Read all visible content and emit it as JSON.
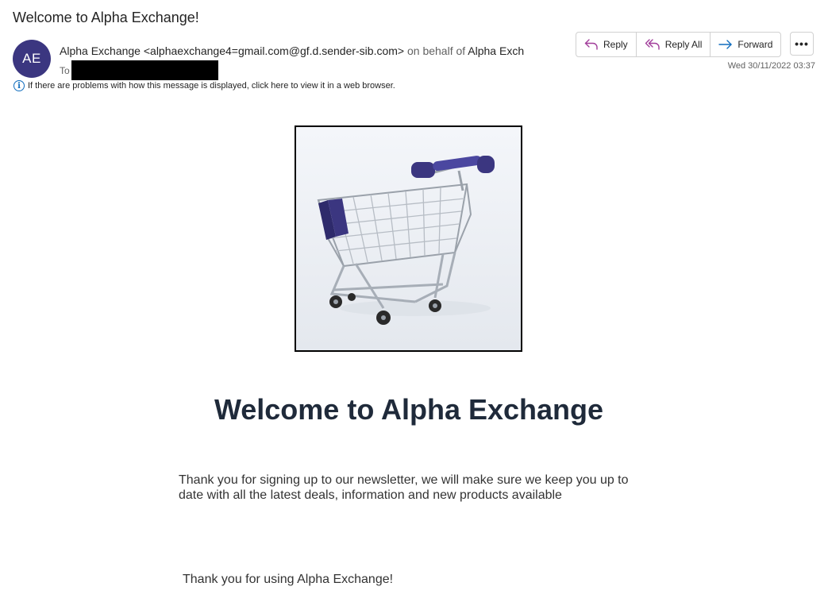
{
  "email": {
    "subject": "Welcome to Alpha Exchange!",
    "avatar_initials": "AE",
    "sender_name": "Alpha Exchange",
    "sender_address": "<alphaexchange4=gmail.com@gf.d.sender-sib.com>",
    "on_behalf_label": "on behalf of",
    "on_behalf_name": "Alpha Exch",
    "to_label": "To",
    "info_notice": "If there are problems with how this message is displayed, click here to view it in a web browser.",
    "date": "Wed 30/11/2022 03:37"
  },
  "actions": {
    "reply": "Reply",
    "reply_all": "Reply All",
    "forward": "Forward",
    "more": "•••"
  },
  "body": {
    "headline": "Welcome to Alpha Exchange",
    "paragraph": "Thank you for signing up to our newsletter, we will make sure we keep you up to date with all the latest deals, information and new products available",
    "closing": "Thank you for using Alpha Exchange!"
  },
  "colors": {
    "avatar": "#3b3680",
    "accent_reply": "#a13d9a",
    "accent_forward": "#0f6cbd",
    "headline": "#1f2a3a"
  }
}
